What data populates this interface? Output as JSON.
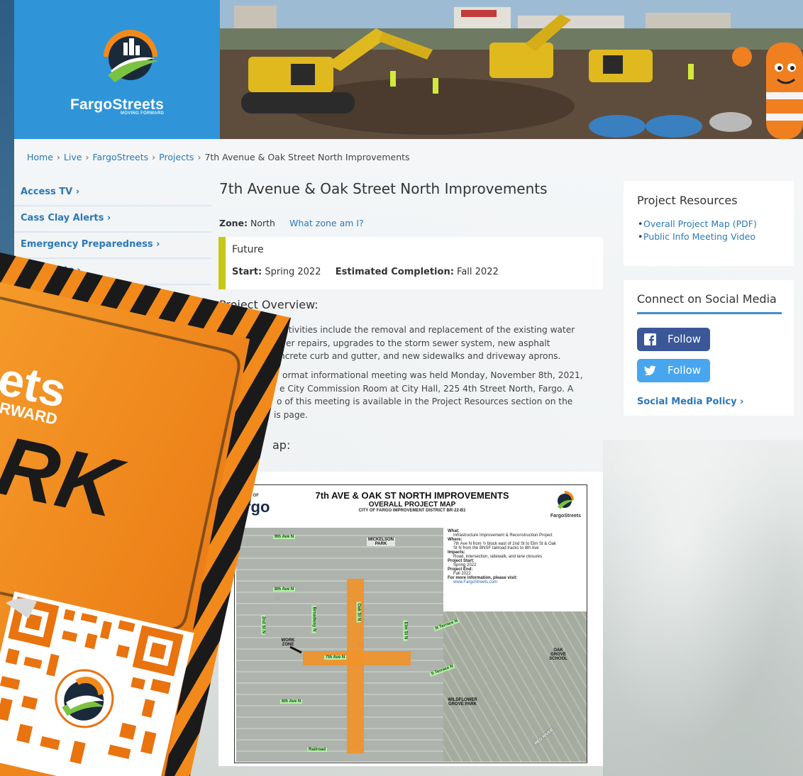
{
  "header": {
    "logo_name": "FargoStreets",
    "logo_tagline": "MOVING FORWARD"
  },
  "breadcrumb": [
    {
      "label": "Home",
      "link": true
    },
    {
      "label": "Live",
      "link": true
    },
    {
      "label": "FargoStreets",
      "link": true
    },
    {
      "label": "Projects",
      "link": true
    },
    {
      "label": "7th Avenue & Oak Street North Improvements",
      "link": false
    }
  ],
  "sidebar": {
    "items": [
      {
        "label": "Access TV ›"
      },
      {
        "label": "Cass Clay Alerts ›"
      },
      {
        "label": "Emergency Preparedness ›"
      },
      {
        "label": "ts ›"
      }
    ]
  },
  "project": {
    "title": "7th Avenue & Oak Street North Improvements",
    "zone_label": "Zone:",
    "zone_value": "North",
    "zone_link": "What zone am I?",
    "status": "Future",
    "start_label": "Start:",
    "start_value": "Spring 2022",
    "completion_label": "Estimated Completion:",
    "completion_value": "Fall 2022",
    "overview_heading": "Project Overview:",
    "paragraph1": [
      "ctivities include the removal and replacement of the existing water",
      "er repairs, upgrades to the storm sewer system, new asphalt",
      "ncrete curb and gutter, and new sidewalks and driveway aprons."
    ],
    "paragraph2": [
      "ormat informational meeting was held Monday, November 8th, 2021,",
      "e City Commission Room at City Hall, 225 4th Street North, Fargo. A",
      "o of this meeting is available in the Project Resources section on the",
      "is page."
    ],
    "map_heading": "ap:"
  },
  "map": {
    "city_fragment": "rgo",
    "city_small": "Y OF",
    "title_line1": "7th AVE & OAK ST NORTH IMPROVEMENTS",
    "title_line2": "OVERALL PROJECT MAP",
    "title_line3": "CITY OF FARGO IMPROVEMENT DISTRICT BR-22-B1",
    "brand": "FargoStreets",
    "info": [
      {
        "k": "What:",
        "v": "Infrastructure Improvement & Reconstruction Project"
      },
      {
        "k": "Where:",
        "v": "7th Ave N from ½ block east of 2nd St to Elm St & Oak"
      },
      {
        "k": "",
        "v": "St N from the BNSF railroad tracks to 8th Ave"
      },
      {
        "k": "Impacts:",
        "v": "Road, intersection, sidewalk, and lane closures"
      },
      {
        "k": "Project Start:",
        "v": "Spring 2022"
      },
      {
        "k": "Project End:",
        "v": "Fall 2022"
      },
      {
        "k": "For more information, please visit:",
        "v": "www.FargoStreets.com"
      }
    ],
    "labels": {
      "l9th": "9th Ave N",
      "l8th": "8th Ave N",
      "l7th": "7th Ave N",
      "l6th": "6th Ave N",
      "railroad": "Railroad",
      "oak": "Oak St N",
      "elm": "Elm St N",
      "broadway": "Broadway N",
      "second": "2nd St N",
      "nterrace": "N Terrace N",
      "sterrace": "S Terrace N",
      "mickelson": "MICKELSON PARK",
      "oakgrove": "OAK GROVE SCHOOL",
      "wildflower": "WILDFLOWER GROVE PARK",
      "workzone": "WORK ZONE",
      "redriver": "RED RIVER"
    }
  },
  "resources": {
    "heading": "Project Resources",
    "links": [
      "Overall Project Map (PDF)",
      "Public Info Meeting Video"
    ]
  },
  "social": {
    "heading": "Connect on Social Media",
    "facebook_label": "Follow",
    "twitter_label": "Follow",
    "policy_link": "Social Media Policy ›"
  },
  "flyer": {
    "brand_fragment": "ets",
    "tagline_fragment": "RWARD",
    "big_word_fragment": "RK"
  },
  "colors": {
    "accent_blue": "#2f95d8",
    "link_blue": "#2a7ab8",
    "status_bar": "#c9c716",
    "flyer_orange": "#f28a1b",
    "facebook": "#3b5797",
    "twitter": "#48a6ee"
  }
}
